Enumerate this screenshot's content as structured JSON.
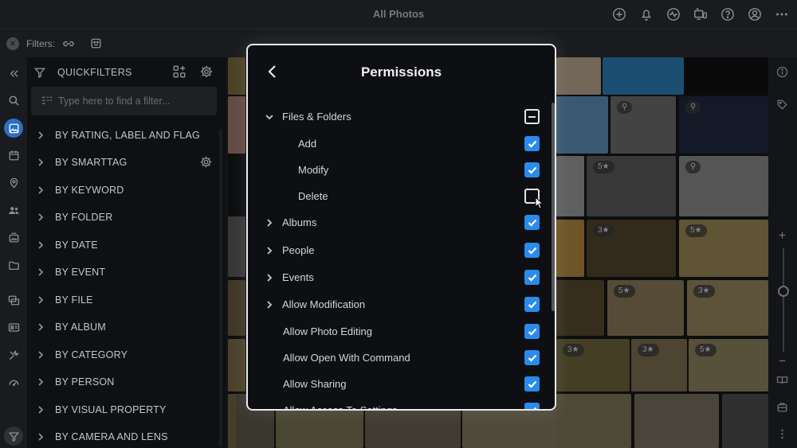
{
  "app": {
    "title": "All Photos"
  },
  "filters": {
    "label": "Filters:"
  },
  "quickfilters": {
    "title": "QUICKFILTERS",
    "search_placeholder": "Type here to find a filter...",
    "items": [
      "BY RATING, LABEL AND FLAG",
      "BY SMARTTAG",
      "BY KEYWORD",
      "BY FOLDER",
      "BY DATE",
      "BY EVENT",
      "BY FILE",
      "BY ALBUM",
      "BY CATEGORY",
      "BY PERSON",
      "BY VISUAL PROPERTY",
      "BY CAMERA AND LENS"
    ]
  },
  "thumb_badges": [
    "5★",
    "3★",
    "5★",
    "3★",
    "5★",
    "3★",
    "5★",
    "3★",
    "3★",
    "5★",
    "3★",
    "3★",
    "5★"
  ],
  "colors": {
    "accent": "#2a8bea",
    "active_rail": "#2a6fc2",
    "background": "#141518"
  },
  "permissions": {
    "title": "Permissions",
    "items": [
      {
        "label": "Files & Folders",
        "state": "partial"
      },
      {
        "label": "Add",
        "state": "checked"
      },
      {
        "label": "Modify",
        "state": "checked"
      },
      {
        "label": "Delete",
        "state": "unchecked"
      },
      {
        "label": "Albums",
        "state": "checked"
      },
      {
        "label": "People",
        "state": "checked"
      },
      {
        "label": "Events",
        "state": "checked"
      },
      {
        "label": "Allow Modification",
        "state": "checked"
      },
      {
        "label": "Allow Photo Editing",
        "state": "checked"
      },
      {
        "label": "Allow Open With Command",
        "state": "checked"
      },
      {
        "label": "Allow Sharing",
        "state": "checked"
      },
      {
        "label": "Allow Access To Settings",
        "state": "checked"
      }
    ]
  }
}
